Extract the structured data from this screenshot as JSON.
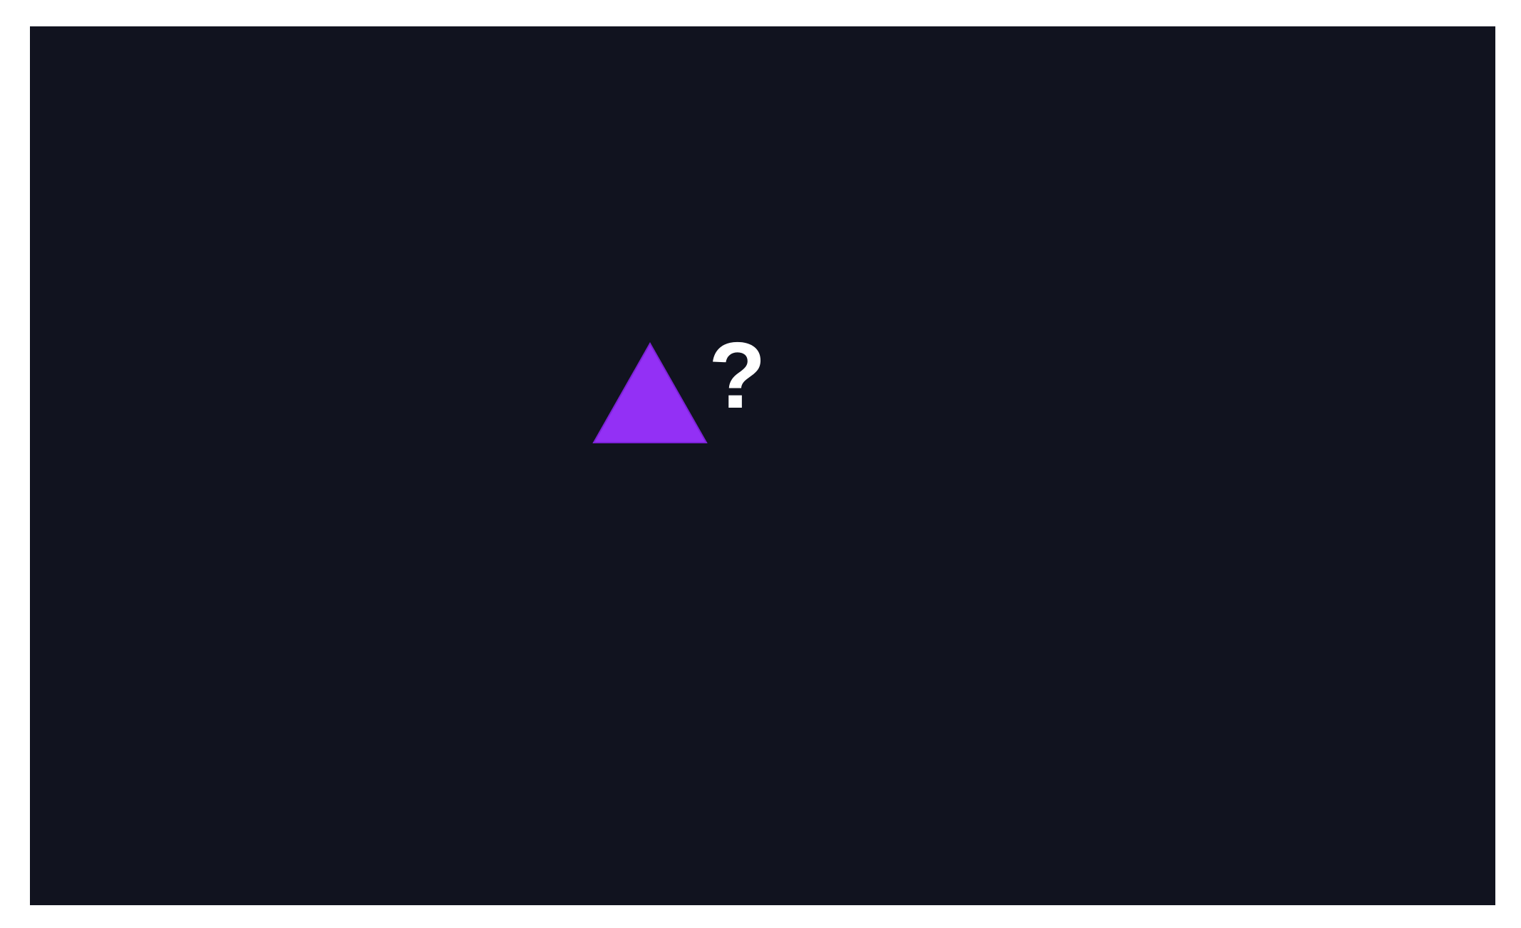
{
  "stage": {
    "background_color": "#11131f",
    "shape": {
      "icon": "triangle-icon",
      "color": "#9330f5"
    },
    "prompt_text": "?"
  }
}
